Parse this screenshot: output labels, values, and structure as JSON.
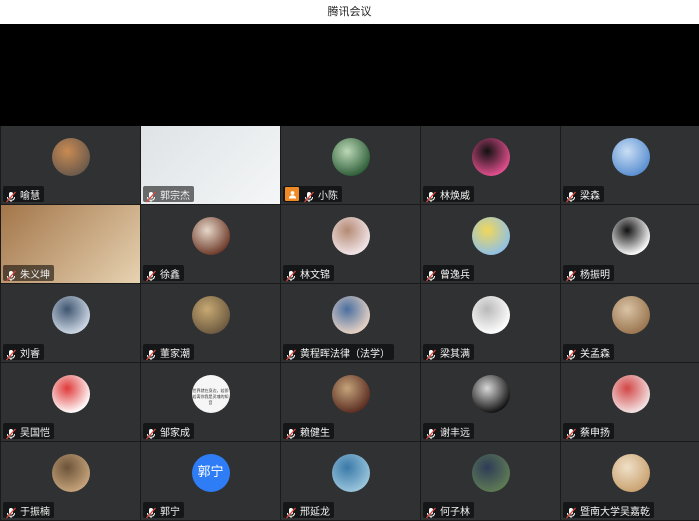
{
  "window": {
    "title": "腾讯会议"
  },
  "participants": [
    {
      "name": "喻慧",
      "kind": "avatar",
      "colors": [
        "#6b5a4c",
        "#c98b52"
      ]
    },
    {
      "name": "郭宗杰",
      "kind": "video",
      "colors": [
        "#dfe3e6",
        "#f4f6f7"
      ]
    },
    {
      "name": "小陈",
      "kind": "avatar",
      "colors": [
        "#2f5f39",
        "#bcd8b6"
      ],
      "host": true
    },
    {
      "name": "林焕威",
      "kind": "avatar",
      "colors": [
        "#e4508f",
        "#111111"
      ]
    },
    {
      "name": "梁森",
      "kind": "avatar",
      "colors": [
        "#5a8fd1",
        "#c9def4"
      ]
    },
    {
      "name": "朱义坤",
      "kind": "video",
      "colors": [
        "#a3764a",
        "#e7d2b1"
      ]
    },
    {
      "name": "徐鑫",
      "kind": "avatar",
      "colors": [
        "#6e3b2b",
        "#e6d7c8"
      ]
    },
    {
      "name": "林文锦",
      "kind": "avatar",
      "colors": [
        "#f2e6ea",
        "#b48a73"
      ]
    },
    {
      "name": "曾逸兵",
      "kind": "avatar",
      "colors": [
        "#8fc0e7",
        "#f1d75a"
      ]
    },
    {
      "name": "杨振明",
      "kind": "avatar",
      "colors": [
        "#ffffff",
        "#111111"
      ]
    },
    {
      "name": "刘睿",
      "kind": "avatar",
      "colors": [
        "#cfd9e6",
        "#3f5670"
      ]
    },
    {
      "name": "董家潮",
      "kind": "avatar",
      "colors": [
        "#6d5a40",
        "#c7a972"
      ]
    },
    {
      "name": "黄程晖法律（法学）",
      "kind": "avatar",
      "colors": [
        "#e8d3c4",
        "#4a6fa0"
      ]
    },
    {
      "name": "梁其满",
      "kind": "avatar",
      "colors": [
        "#ffffff",
        "#b9b9b9"
      ]
    },
    {
      "name": "关孟森",
      "kind": "avatar",
      "colors": [
        "#9a7650",
        "#d9c3a5"
      ]
    },
    {
      "name": "吴国恺",
      "kind": "avatar",
      "colors": [
        "#ffffff",
        "#e03a3a"
      ]
    },
    {
      "name": "邹家成",
      "kind": "note",
      "note": "世界就在身边，若即若离你我是灵魂的知音"
    },
    {
      "name": "赖健生",
      "kind": "avatar",
      "colors": [
        "#5a2d22",
        "#c5a37a"
      ]
    },
    {
      "name": "谢丰远",
      "kind": "avatar",
      "colors": [
        "#111111",
        "#d8d8d8"
      ]
    },
    {
      "name": "蔡申扬",
      "kind": "avatar",
      "colors": [
        "#f3e4e4",
        "#d34747"
      ]
    },
    {
      "name": "于振楠",
      "kind": "avatar",
      "colors": [
        "#c6a47c",
        "#6c5338"
      ]
    },
    {
      "name": "郭宁",
      "kind": "text",
      "label": "郭宁",
      "color": "#2e7df6"
    },
    {
      "name": "邢延龙",
      "kind": "avatar",
      "colors": [
        "#9bc6dc",
        "#3a79a8"
      ]
    },
    {
      "name": "何子林",
      "kind": "avatar",
      "colors": [
        "#5f7b55",
        "#2e3c57"
      ]
    },
    {
      "name": "暨南大学吴嘉乾",
      "kind": "avatar",
      "colors": [
        "#c9a270",
        "#f0e0c8"
      ]
    }
  ]
}
